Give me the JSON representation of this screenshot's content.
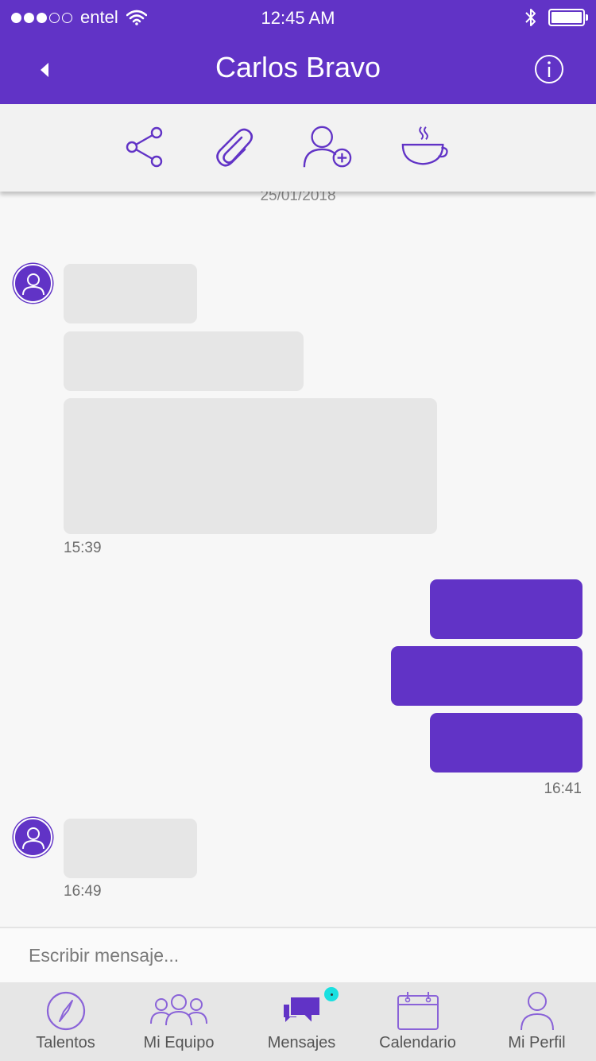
{
  "status_bar": {
    "carrier": "entel",
    "time": "12:45 AM"
  },
  "header": {
    "title": "Carlos Bravo"
  },
  "toolbar": {
    "icons": [
      "share-icon",
      "paperclip-icon",
      "add-user-icon",
      "coffee-cup-icon"
    ]
  },
  "chat": {
    "date": "25/01/2018",
    "groups": [
      {
        "from": "contact",
        "time": "15:39"
      },
      {
        "from": "me",
        "time": "16:41"
      },
      {
        "from": "contact",
        "time": "16:49"
      }
    ]
  },
  "compose": {
    "placeholder": "Escribir mensaje..."
  },
  "tabbar": {
    "items": [
      {
        "label": "Talentos",
        "icon": "compass-icon"
      },
      {
        "label": "Mi Equipo",
        "icon": "team-icon"
      },
      {
        "label": "Mensajes",
        "icon": "messages-icon",
        "active": true,
        "badge": true
      },
      {
        "label": "Calendario",
        "icon": "calendar-icon"
      },
      {
        "label": "Mi Perfil",
        "icon": "profile-icon"
      }
    ]
  },
  "colors": {
    "brand": "#6133c6",
    "incoming_bubble": "#e6e6e6",
    "badge": "#19e0e0"
  }
}
